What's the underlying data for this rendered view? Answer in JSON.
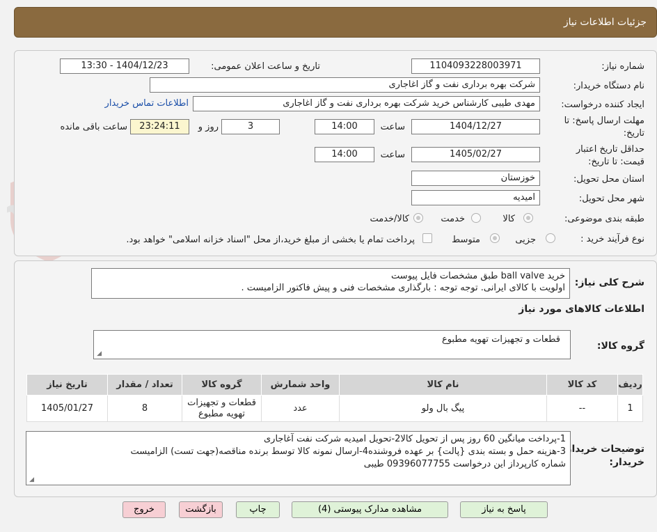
{
  "header": {
    "title": "جزئیات اطلاعات نیاز"
  },
  "watermark": {
    "text": "AriaTender.neT"
  },
  "form": {
    "need_number_label": "شماره نیاز:",
    "need_number": "1104093228003971",
    "announce_label": "تاریخ و ساعت اعلان عمومی:",
    "announce_value": "1404/12/23 - 13:30",
    "buyer_org_label": "نام دستگاه خریدار:",
    "buyer_org": "شرکت بهره برداری نفت و گاز اغاجاری",
    "requester_label": "ایجاد کننده درخواست:",
    "requester": "مهدی طیبی کارشناس خرید شرکت بهره برداری نفت و گاز اغاجاری",
    "contact_link": "اطلاعات تماس خریدار",
    "deadline_label_1": "مهلت ارسال پاسخ: تا",
    "deadline_label_2": "تاریخ:",
    "deadline_date": "1404/12/27",
    "time_label": "ساعت",
    "deadline_time": "14:00",
    "days_value": "3",
    "days_label": "روز و",
    "remaining_time": "23:24:11",
    "remaining_label": "ساعت باقی مانده",
    "validity_label_1": "حداقل تاریخ اعتبار",
    "validity_label_2": "قیمت: تا تاریخ:",
    "validity_date": "1405/02/27",
    "validity_time": "14:00",
    "province_label": "استان محل تحویل:",
    "province": "خوزستان",
    "city_label": "شهر محل تحویل:",
    "city": "امیدیه",
    "category_label": "طبقه بندی موضوعی:",
    "category_options": [
      "کالا",
      "خدمت",
      "کالا/خدمت"
    ],
    "purchase_type_label": "نوع فرآیند خرید :",
    "purchase_options": [
      "جزیی",
      "متوسط"
    ],
    "payment_note": "پرداخت تمام یا بخشی از مبلغ خرید،از محل \"اسناد خزانه اسلامی\" خواهد بود."
  },
  "summary": {
    "label": "شرح کلی نیاز:",
    "line1": "خرید ball valve طبق مشخصات فایل پیوست",
    "line2": "اولویت با کالای ایرانی. توجه توجه : بارگذاری مشخصات فنی و پیش فاکتور الزامیست ."
  },
  "goods_section_title": "اطلاعات کالاهای مورد نیاز",
  "goods_group": {
    "label": "گروه کالا:",
    "value": "قطعات و تجهیزات تهویه مطبوع"
  },
  "table": {
    "headers": [
      "ردیف",
      "کد کالا",
      "نام کالا",
      "واحد شمارش",
      "گروه کالا",
      "تعداد / مقدار",
      "تاریخ نیاز"
    ],
    "rows": [
      [
        "1",
        "--",
        "پیگ بال ولو",
        "عدد",
        "قطعات و تجهیزات تهویه مطبوع",
        "8",
        "1405/01/27"
      ]
    ]
  },
  "buyer_notes": {
    "label": "توضیحات خریدار:",
    "line1": "1-پرداخت میانگین 60 روز پس از تحویل کالا2-تحویل امیدیه شرکت نفت آغاجاری",
    "line2": "3-هزینه حمل  و بسته بندی {پالت} بر عهده فروشنده4-ارسال نمونه کالا توسط برنده مناقصه(جهت تست) الزامیست",
    "line3": "شماره کارپرداز این درخواست 09396077755 طیبی"
  },
  "buttons": {
    "reply": "پاسخ به نیاز",
    "attachments": "مشاهده مدارک پیوستی (4)",
    "print": "چاپ",
    "back": "بازگشت",
    "exit": "خروج"
  }
}
